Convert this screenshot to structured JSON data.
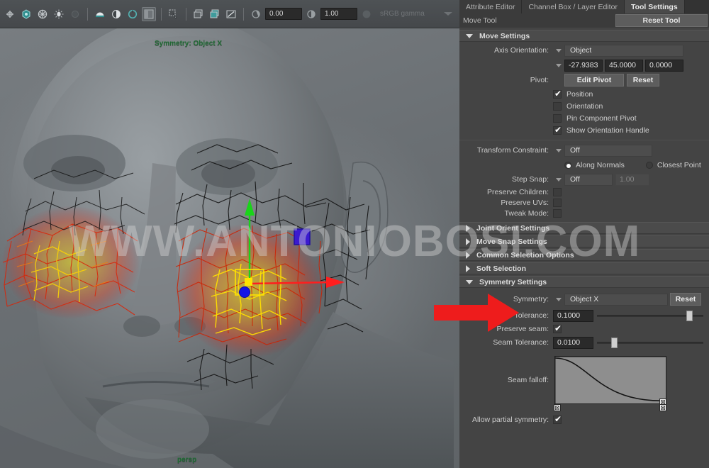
{
  "toolbar": {
    "icons": [
      "snap-to-grid-icon",
      "snap-to-curve-icon",
      "snap-to-point-icon",
      "snap-to-projected-center-icon",
      "snap-to-view-plane-icon",
      "make-live-icon",
      "render-current-frame-icon",
      "ipr-render-icon",
      "render-settings-icon",
      "hypershade-icon",
      "select-by-component-icon",
      "open-render-view-icon",
      "display-layer-icon",
      "image-plane-icon",
      "exposure-icon",
      "gamma-icon",
      "color-management-icon"
    ],
    "exposure_value": "0.00",
    "gamma_value": "1.00",
    "color_profile": "sRGB gamma"
  },
  "viewport": {
    "symmetry_hud": "Symmetry: Object X",
    "camera_label": "persp",
    "watermark": "WWW.ANTONIOBOSI.COM"
  },
  "tabs": [
    {
      "label": "Attribute Editor",
      "selected": false
    },
    {
      "label": "Channel Box / Layer Editor",
      "selected": false
    },
    {
      "label": "Tool Settings",
      "selected": true
    }
  ],
  "subbar": {
    "tool_name": "Move Tool",
    "reset_tool_label": "Reset Tool"
  },
  "move_settings": {
    "title": "Move Settings",
    "expanded": true,
    "axis_orientation": {
      "label": "Axis Orientation:",
      "value": "Object"
    },
    "axis_values": [
      "-27.9383",
      "45.0000",
      "0.0000"
    ],
    "pivot": {
      "label": "Pivot:",
      "edit_label": "Edit Pivot",
      "reset_label": "Reset"
    },
    "checkboxes": [
      {
        "label": "Position",
        "checked": true
      },
      {
        "label": "Orientation",
        "checked": false
      },
      {
        "label": "Pin Component Pivot",
        "checked": false
      },
      {
        "label": "Show Orientation Handle",
        "checked": true
      }
    ],
    "transform_constraint": {
      "label": "Transform Constraint:",
      "value": "Off"
    },
    "constraint_modes": [
      {
        "label": "Along Normals",
        "selected": true
      },
      {
        "label": "Closest Point",
        "selected": false
      }
    ],
    "step_snap": {
      "label": "Step Snap:",
      "value": "Off",
      "amount": "1.00"
    },
    "flags": [
      {
        "label": "Preserve Children:",
        "checked": false
      },
      {
        "label": "Preserve UVs:",
        "checked": false
      },
      {
        "label": "Tweak Mode:",
        "checked": false
      }
    ]
  },
  "collapsed_sections": [
    {
      "label": "Joint Orient Settings"
    },
    {
      "label": "Move Snap Settings"
    },
    {
      "label": "Common Selection Options"
    },
    {
      "label": "Soft Selection"
    }
  ],
  "symmetry_settings": {
    "title": "Symmetry Settings",
    "expanded": true,
    "symmetry": {
      "label": "Symmetry:",
      "value": "Object X",
      "reset_label": "Reset"
    },
    "tolerance": {
      "label": "Tolerance:",
      "value": "0.1000",
      "slider_pct": 88
    },
    "preserve_seam": {
      "label": "Preserve seam:",
      "checked": true
    },
    "seam_tolerance": {
      "label": "Seam Tolerance:",
      "value": "0.0100",
      "slider_pct": 14
    },
    "seam_falloff": {
      "label": "Seam falloff:"
    },
    "allow_partial": {
      "label": "Allow partial symmetry:",
      "checked": true
    }
  },
  "colors": {
    "panel_bg": "#444444",
    "tab_selected_bg": "#4a4a4a",
    "accent_green": "#1f6b33",
    "annotation_red": "#ee1c1c",
    "field_dark": "#2a2a2a"
  }
}
